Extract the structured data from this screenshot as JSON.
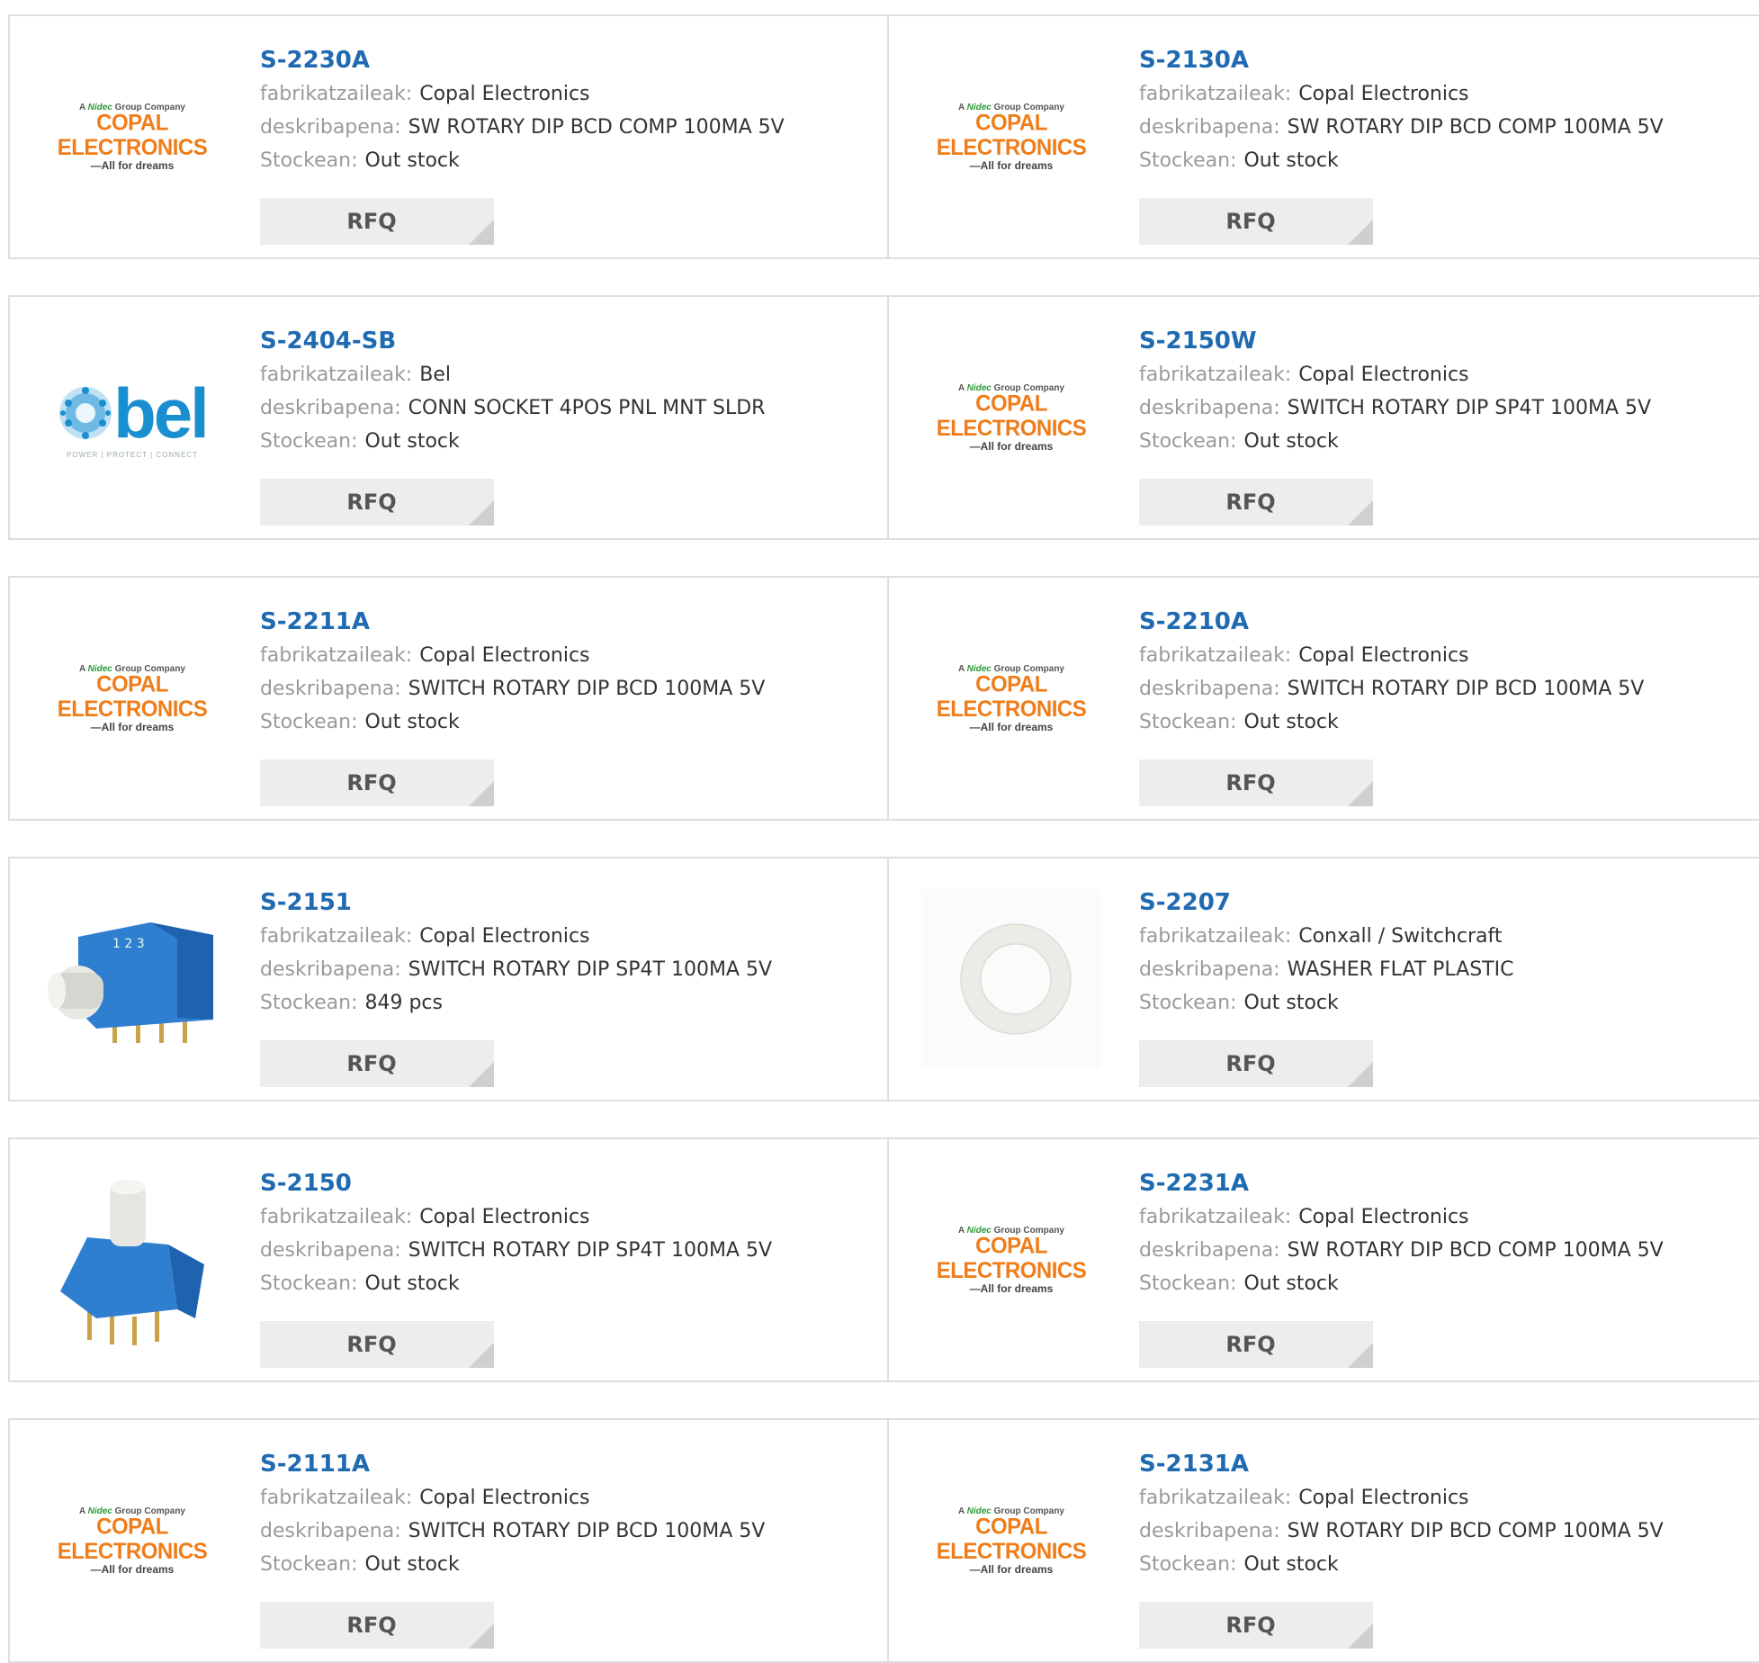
{
  "labels": {
    "manufacturer": "fabrikatzaileak:",
    "description": "deskribapena:",
    "stock": "Stockean:",
    "rfq": "RFQ"
  },
  "logos": {
    "copal": {
      "top_a": "A",
      "top_nidec": "Nidec",
      "top_rest": "Group Company",
      "main": "COPAL ELECTRONICS",
      "sub": "—All for dreams"
    },
    "bel": {
      "word": "bel",
      "tag": "POWER | PROTECT | CONNECT"
    }
  },
  "colors": {
    "part_link": "#1f6ab0",
    "label": "#9a9a9a",
    "value": "#333333",
    "rfq_bg": "#ededed",
    "copal_orange": "#ef7d1a",
    "bel_blue": "#1a8fd0"
  },
  "products": [
    {
      "part": "S-2230A",
      "manufacturer": "Copal Electronics",
      "description": "SW ROTARY DIP BCD COMP 100MA 5V",
      "stock": "Out stock",
      "image": "copal-logo"
    },
    {
      "part": "S-2130A",
      "manufacturer": "Copal Electronics",
      "description": "SW ROTARY DIP BCD COMP 100MA 5V",
      "stock": "Out stock",
      "image": "copal-logo"
    },
    {
      "part": "S-2404-SB",
      "manufacturer": "Bel",
      "description": "CONN SOCKET 4POS PNL MNT SLDR",
      "stock": "Out stock",
      "image": "bel-logo"
    },
    {
      "part": "S-2150W",
      "manufacturer": "Copal Electronics",
      "description": "SWITCH ROTARY DIP SP4T 100MA 5V",
      "stock": "Out stock",
      "image": "copal-logo"
    },
    {
      "part": "S-2211A",
      "manufacturer": "Copal Electronics",
      "description": "SWITCH ROTARY DIP BCD 100MA 5V",
      "stock": "Out stock",
      "image": "copal-logo"
    },
    {
      "part": "S-2210A",
      "manufacturer": "Copal Electronics",
      "description": "SWITCH ROTARY DIP BCD 100MA 5V",
      "stock": "Out stock",
      "image": "copal-logo"
    },
    {
      "part": "S-2151",
      "manufacturer": "Copal Electronics",
      "description": "SWITCH ROTARY DIP SP4T 100MA 5V",
      "stock": "849 pcs",
      "image": "rotary-switch-side-photo"
    },
    {
      "part": "S-2207",
      "manufacturer": "Conxall / Switchcraft",
      "description": "WASHER FLAT PLASTIC",
      "stock": "Out stock",
      "image": "washer-photo"
    },
    {
      "part": "S-2150",
      "manufacturer": "Copal Electronics",
      "description": "SWITCH ROTARY DIP SP4T 100MA 5V",
      "stock": "Out stock",
      "image": "rotary-switch-top-photo"
    },
    {
      "part": "S-2231A",
      "manufacturer": "Copal Electronics",
      "description": "SW ROTARY DIP BCD COMP 100MA 5V",
      "stock": "Out stock",
      "image": "copal-logo"
    },
    {
      "part": "S-2111A",
      "manufacturer": "Copal Electronics",
      "description": "SWITCH ROTARY DIP BCD 100MA 5V",
      "stock": "Out stock",
      "image": "copal-logo"
    },
    {
      "part": "S-2131A",
      "manufacturer": "Copal Electronics",
      "description": "SW ROTARY DIP BCD COMP 100MA 5V",
      "stock": "Out stock",
      "image": "copal-logo"
    }
  ]
}
